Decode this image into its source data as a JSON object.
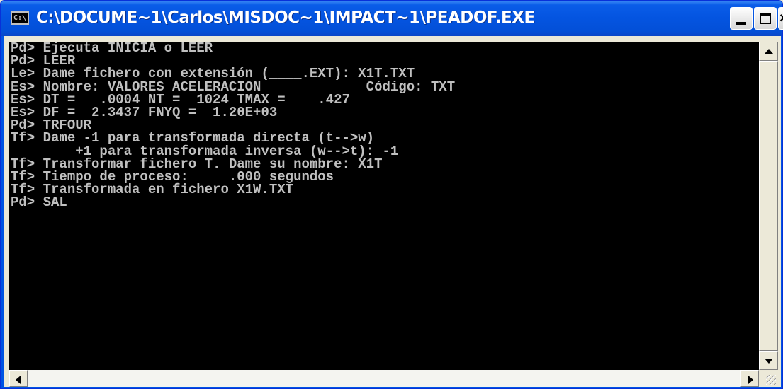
{
  "window": {
    "title": "C:\\DOCUME~1\\Carlos\\MISDOC~1\\IMPACT~1\\PEADOF.EXE",
    "icon": "console-icon",
    "icon_label": "C:\\"
  },
  "console": {
    "lines": [
      "Pd> Ejecuta INICIA o LEER",
      "Pd> LEER",
      "Le> Dame fichero con extensión (____.EXT): X1T.TXT",
      "Es> Nombre: VALORES ACELERACION             Código: TXT",
      "Es> DT =   .0004 NT =  1024 TMAX =    .427",
      "Es> DF =  2.3437 FNYQ =  1.20E+03",
      "Pd> TRFOUR",
      "Tf> Dame -1 para transformada directa (t-->w)",
      "        +1 para transformada inversa (w-->t): -1",
      "Tf> Transformar fichero T. Dame su nombre: X1T",
      "Tf> Tiempo de proceso:     .000 segundos",
      "Tf> Transformada en fichero X1W.TXT",
      "Pd> SAL"
    ]
  },
  "colors": {
    "titlebar": "#0454e0",
    "console_bg": "#000000",
    "console_fg": "#c0c0c0"
  }
}
